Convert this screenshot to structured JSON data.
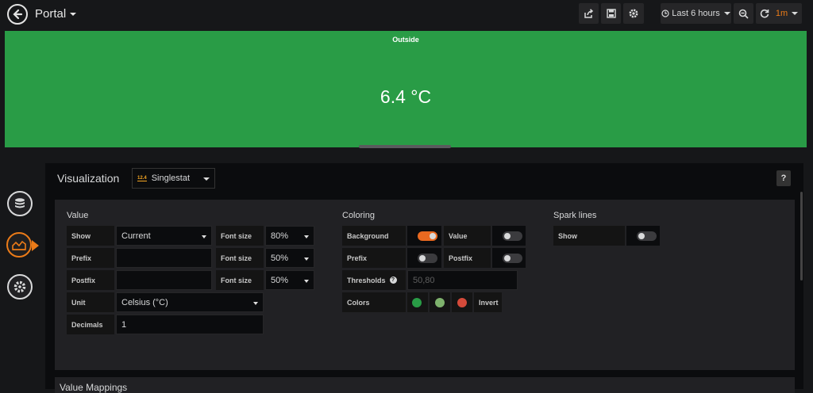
{
  "header": {
    "title": "Portal",
    "time_range": "Last 6 hours",
    "refresh_interval": "1m"
  },
  "panel": {
    "title": "Outside",
    "value": "6.4 °C",
    "background_color": "#299c46"
  },
  "visualization": {
    "label": "Visualization",
    "type_badge": "12.4",
    "type": "Singlestat",
    "help": "?"
  },
  "value_section": {
    "title": "Value",
    "show_label": "Show",
    "show_value": "Current",
    "prefix_label": "Prefix",
    "prefix_value": "",
    "postfix_label": "Postfix",
    "postfix_value": "",
    "font_size_label": "Font size",
    "value_font_size": "80%",
    "prefix_font_size": "50%",
    "postfix_font_size": "50%",
    "unit_label": "Unit",
    "unit_value": "Celsius (°C)",
    "decimals_label": "Decimals",
    "decimals_value": "1"
  },
  "coloring_section": {
    "title": "Coloring",
    "background_label": "Background",
    "background_on": true,
    "value_label": "Value",
    "value_on": false,
    "prefix_label": "Prefix",
    "prefix_on": false,
    "postfix_label": "Postfix",
    "postfix_on": false,
    "thresholds_label": "Thresholds",
    "thresholds_placeholder": "50,80",
    "colors_label": "Colors",
    "colors": [
      "#299c46",
      "#7eb26d",
      "#d44a3a"
    ],
    "invert_label": "Invert"
  },
  "spark_section": {
    "title": "Spark lines",
    "show_label": "Show",
    "show_on": false
  },
  "value_mappings": {
    "title": "Value Mappings"
  },
  "colors": {
    "accent": "#e96920",
    "panel_green": "#299c46"
  }
}
